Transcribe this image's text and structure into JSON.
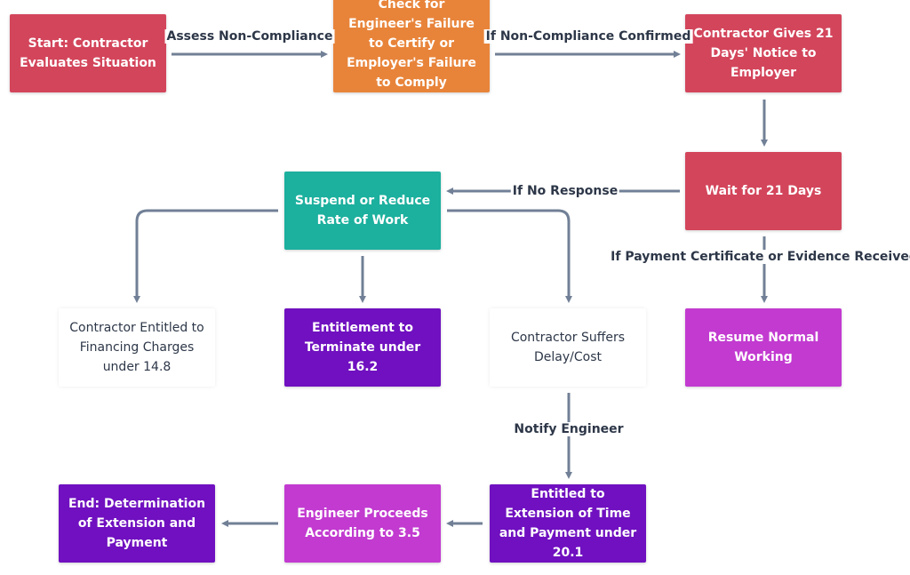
{
  "colors": {
    "red": "#d3455b",
    "orange": "#e8843a",
    "teal": "#1cb09e",
    "purple": "#7010c0",
    "magenta": "#c23ad0",
    "white": "#ffffff",
    "edge": "#718096"
  },
  "nodes": {
    "start": "Start: Contractor Evaluates Situation",
    "check": "Check for Engineer's Failure to Certify or Employer's Failure to Comply",
    "notice": "Contractor Gives 21 Days' Notice to Employer",
    "wait": "Wait for 21 Days",
    "suspend": "Suspend or Reduce Rate of Work",
    "financing": "Contractor Entitled to Financing Charges under 14.8",
    "terminate": "Entitlement to Terminate under 16.2",
    "delay": "Contractor Suffers Delay/Cost",
    "resume": "Resume Normal Working",
    "extension": "Entitled to Extension of Time and Payment under 20.1",
    "engineer": "Engineer Proceeds According to 3.5",
    "end": "End: Determination of Extension and Payment"
  },
  "edge_labels": {
    "assess": "Assess Non-Compliance",
    "confirmed": "If Non-Compliance Confirmed",
    "no_response": "If No Response",
    "received": "If Payment Certificate or Evidence Received",
    "notify": "Notify Engineer"
  }
}
